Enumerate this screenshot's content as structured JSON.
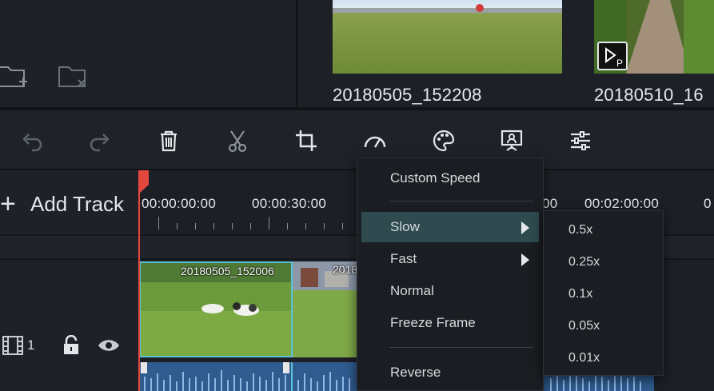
{
  "media": {
    "thumbnails": [
      {
        "label": "20180505_152208"
      },
      {
        "label": "20180510_16"
      }
    ]
  },
  "toolbar": {
    "tools": [
      "undo-icon",
      "redo-icon",
      "trash-icon",
      "scissors-icon",
      "crop-icon",
      "speed-gauge-icon",
      "palette-icon",
      "presentation-icon",
      "sliders-icon"
    ]
  },
  "timeline": {
    "add_track_label": "Add Track",
    "timecodes": [
      "00:00:00:00",
      "00:00:30:00",
      "00",
      "00:02:00:00",
      "0"
    ],
    "clips": [
      {
        "title": "20180505_152006"
      },
      {
        "title": "2018"
      }
    ],
    "track_number": "1"
  },
  "speed_menu": {
    "items": [
      {
        "label": "Custom Speed"
      },
      {
        "label": "Slow"
      },
      {
        "label": "Fast"
      },
      {
        "label": "Normal"
      },
      {
        "label": "Freeze Frame"
      },
      {
        "label": "Reverse"
      }
    ],
    "slow_options": [
      "0.5x",
      "0.25x",
      "0.1x",
      "0.05x",
      "0.01x"
    ]
  },
  "colors": {
    "accent_playhead": "#e2483d",
    "menu_highlight": "#2f4b4f",
    "audio_track": "#2f5b8f",
    "selected_clip_border": "#5bc3d8"
  }
}
